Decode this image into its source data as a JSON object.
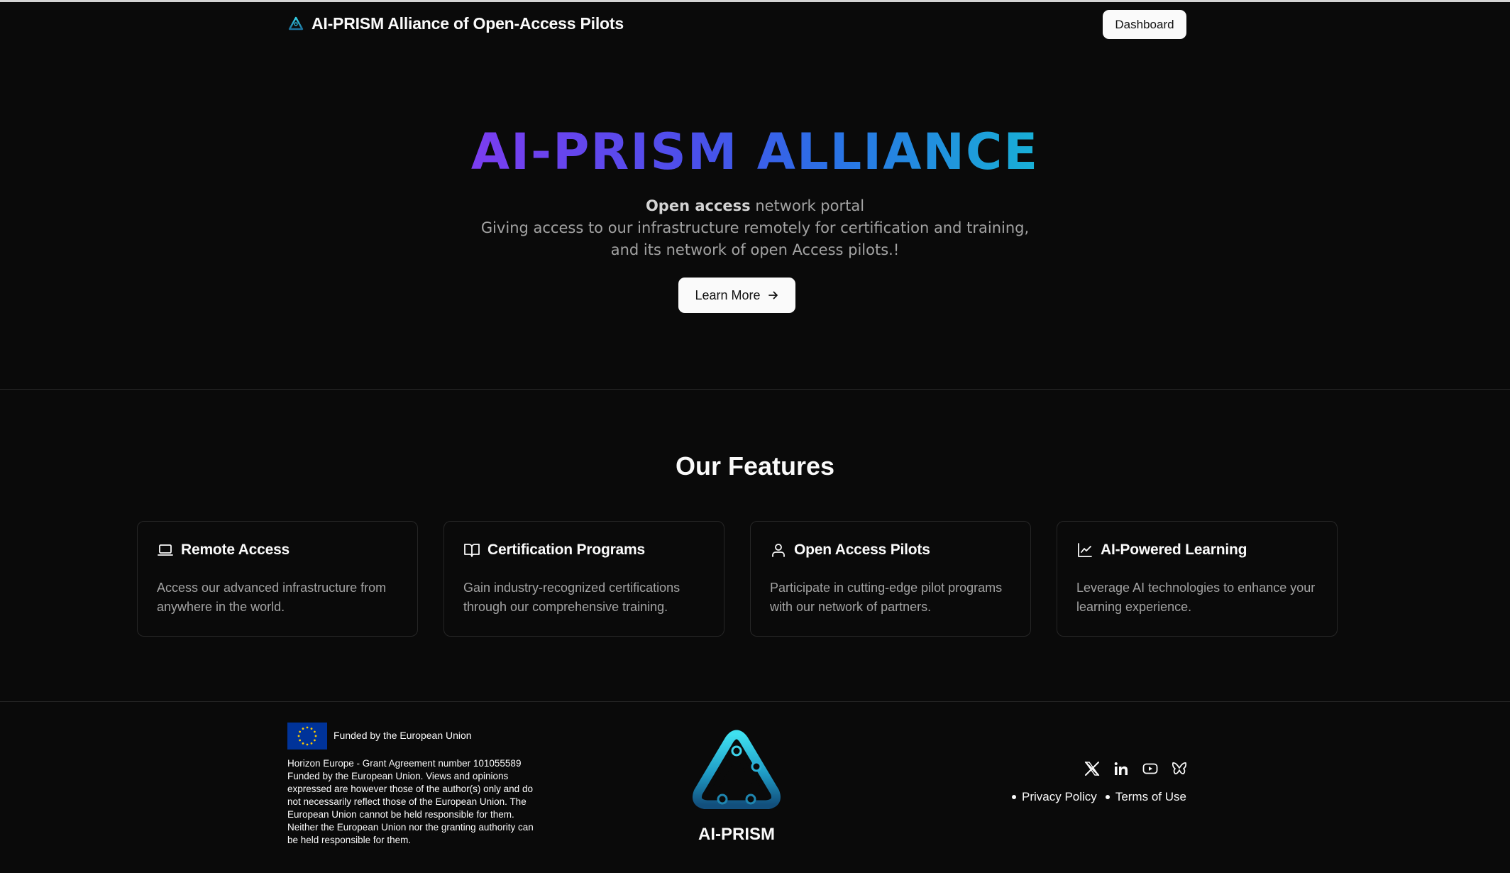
{
  "header": {
    "brand": "AI-PRISM Alliance of Open-Access Pilots",
    "dashboard_label": "Dashboard"
  },
  "hero": {
    "title": "AI-PRISM ALLIANCE",
    "subtitle_bold": "Open access",
    "subtitle_rest": " network portal",
    "description": "Giving access to our infrastructure remotely for certification and training, and its network of open Access pilots.!",
    "cta_label": "Learn More"
  },
  "features": {
    "title": "Our Features",
    "cards": [
      {
        "icon": "laptop-icon",
        "title": "Remote Access",
        "description": "Access our advanced infrastructure from anywhere in the world."
      },
      {
        "icon": "book-open-icon",
        "title": "Certification Programs",
        "description": "Gain industry-recognized certifications through our comprehensive training."
      },
      {
        "icon": "user-icon",
        "title": "Open Access Pilots",
        "description": "Participate in cutting-edge pilot programs with our network of partners."
      },
      {
        "icon": "line-chart-icon",
        "title": "AI-Powered Learning",
        "description": "Leverage AI technologies to enhance your learning experience."
      }
    ]
  },
  "footer": {
    "eu_label": "Funded by the European Union",
    "eu_disclaimer": "Horizon Europe - Grant Agreement number 101055589 Funded by the European Union. Views and opinions expressed are however those of the author(s) only and do not necessarily reflect those of the European Union. The European Union cannot be held responsible for them. Neither the European Union nor the granting authority can be held responsible for them.",
    "logo_name": "AI-PRISM",
    "social": [
      "x-icon",
      "linkedin-icon",
      "youtube-icon",
      "bluesky-icon"
    ],
    "privacy_label": "Privacy Policy",
    "terms_label": "Terms of Use"
  },
  "colors": {
    "background": "#0a0a0a",
    "gradient_start": "#7b3df0",
    "gradient_end": "#18b0d6",
    "logo_cyan": "#2ec4df",
    "eu_blue": "#003399",
    "eu_star": "#ffcc00"
  }
}
